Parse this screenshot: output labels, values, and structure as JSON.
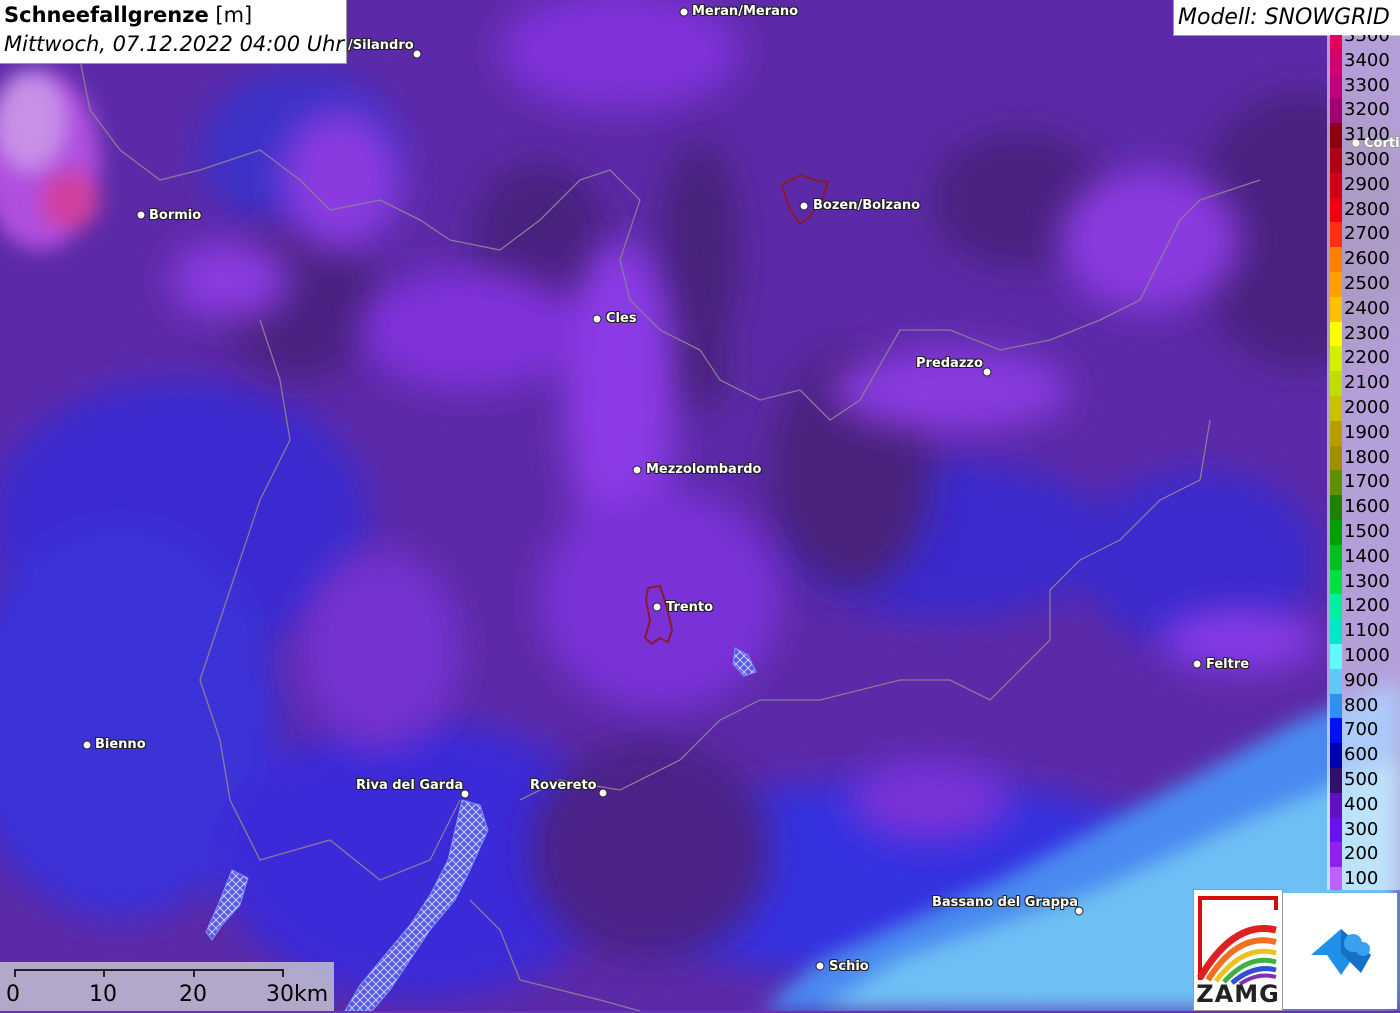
{
  "title": {
    "variable": "Schneefallgrenze",
    "unit": "[m]",
    "datetime": "Mittwoch, 07.12.2022 04:00 Uhr"
  },
  "model": "Modell: SNOWGRID",
  "legend": [
    {
      "label": "3500",
      "color": "#e6005a"
    },
    {
      "label": "3400",
      "color": "#d40070"
    },
    {
      "label": "3300",
      "color": "#c0007a"
    },
    {
      "label": "3200",
      "color": "#a00070"
    },
    {
      "label": "3100",
      "color": "#8c0010"
    },
    {
      "label": "3000",
      "color": "#b00018"
    },
    {
      "label": "2900",
      "color": "#d00018"
    },
    {
      "label": "2800",
      "color": "#f00010"
    },
    {
      "label": "2700",
      "color": "#ff3010"
    },
    {
      "label": "2600",
      "color": "#ff8000"
    },
    {
      "label": "2500",
      "color": "#ffa000"
    },
    {
      "label": "2400",
      "color": "#ffc000"
    },
    {
      "label": "2300",
      "color": "#ffff00"
    },
    {
      "label": "2200",
      "color": "#d4f000"
    },
    {
      "label": "2100",
      "color": "#c0dc00"
    },
    {
      "label": "2000",
      "color": "#c8c000"
    },
    {
      "label": "1900",
      "color": "#b89c00"
    },
    {
      "label": "1800",
      "color": "#a09000"
    },
    {
      "label": "1700",
      "color": "#609000"
    },
    {
      "label": "1600",
      "color": "#208000"
    },
    {
      "label": "1500",
      "color": "#00a000"
    },
    {
      "label": "1400",
      "color": "#00c020"
    },
    {
      "label": "1300",
      "color": "#00e040"
    },
    {
      "label": "1200",
      "color": "#00f0a0"
    },
    {
      "label": "1100",
      "color": "#00e8c8"
    },
    {
      "label": "1000",
      "color": "#60f8f8"
    },
    {
      "label": "900",
      "color": "#60c8f8"
    },
    {
      "label": "800",
      "color": "#3090f0"
    },
    {
      "label": "700",
      "color": "#0010f0"
    },
    {
      "label": "600",
      "color": "#0000b0"
    },
    {
      "label": "500",
      "color": "#30106a"
    },
    {
      "label": "400",
      "color": "#6010c0"
    },
    {
      "label": "300",
      "color": "#6810f0"
    },
    {
      "label": "200",
      "color": "#9020f0"
    },
    {
      "label": "100",
      "color": "#c060ff"
    }
  ],
  "cities": [
    {
      "name": "Meran/Merano"
    },
    {
      "name": "/Silandro"
    },
    {
      "name": "Bormio"
    },
    {
      "name": "Bozen/Bolzano"
    },
    {
      "name": "Cles"
    },
    {
      "name": "Predazzo"
    },
    {
      "name": "Mezzolombardo"
    },
    {
      "name": "Trento"
    },
    {
      "name": "Feltre"
    },
    {
      "name": "Bienno"
    },
    {
      "name": "Riva del Garda"
    },
    {
      "name": "Rovereto"
    },
    {
      "name": "Bassano del Grappa"
    },
    {
      "name": "Schio"
    },
    {
      "name": "Corti"
    }
  ],
  "scale": {
    "labels": [
      "0",
      "10",
      "20",
      "30km"
    ]
  },
  "logo": {
    "zamg": "ZAMG"
  },
  "colors": {
    "base": "#5a2aa0",
    "dark": "#4a247a",
    "light": "#8a3ae8",
    "blue": "#3a2ad0",
    "lightblue": "#6ec0f4",
    "midblue": "#4a90f0"
  }
}
